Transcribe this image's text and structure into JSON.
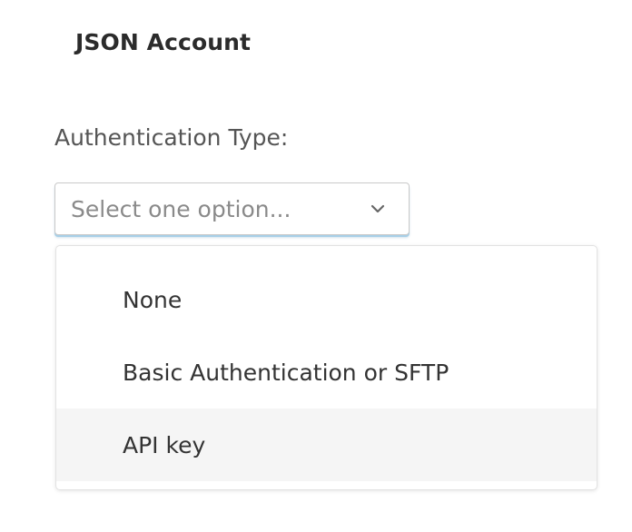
{
  "header": {
    "title": "JSON Account"
  },
  "form": {
    "auth_type": {
      "label": "Authentication Type:",
      "placeholder": "Select one option...",
      "icon": "chevron-down-icon",
      "options": [
        {
          "label": "None"
        },
        {
          "label": "Basic Authentication or SFTP"
        },
        {
          "label": "API key"
        }
      ],
      "highlighted_option": "API key"
    }
  },
  "colors": {
    "focus_underline": "#a8d0e8",
    "highlight_row": "#f5f5f5"
  }
}
